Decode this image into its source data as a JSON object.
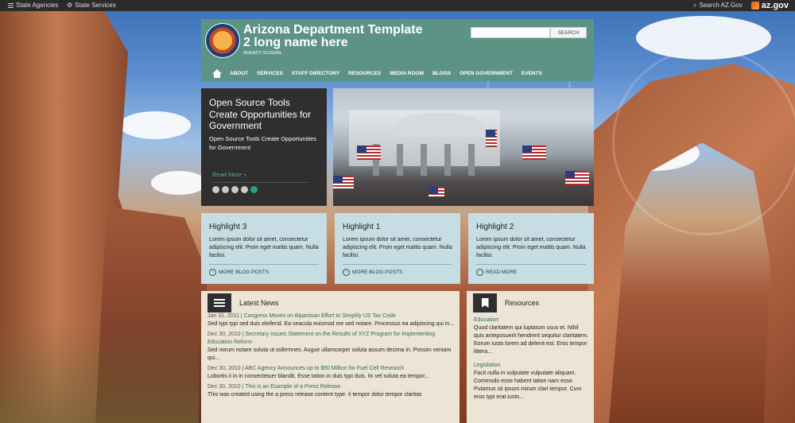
{
  "topbar": {
    "agencies": "State Agencies",
    "services": "State Services",
    "search": "Search AZ.Gov",
    "logo": "az.gov"
  },
  "header": {
    "title": "Arizona Department Template 2 long name here",
    "slogan": "AGENCY SLOGAN",
    "search_placeholder": "",
    "search_button": "SEARCH",
    "nav": [
      "ABOUT",
      "SERVICES",
      "STAFF DIRECTORY",
      "RESOURCES",
      "MEDIA ROOM",
      "BLOGS",
      "OPEN GOVERNMENT",
      "EVENTS"
    ]
  },
  "slider": {
    "title": "Open Source Tools Create Opportunities for Government",
    "subtitle": "Open Source Tools Create Opportunities for Government",
    "read_more": "Read More »",
    "active_dot": 5,
    "dot_count": 5
  },
  "highlights": [
    {
      "title": "Highlight 3",
      "body": "Lorem ipsum dolor sit amet, consectetur adipiscing elit. Proin eget mattis quam. Nulla facilisi.",
      "link": "MORE BLOG POSTS"
    },
    {
      "title": "Highlight 1",
      "body": "Lorem ipsum dolor sit amet, consectetur adipiscing elit. Proin eget mattis quam. Nulla facilisi.",
      "link": "MORE BLOG POSTS"
    },
    {
      "title": "Highlight 2",
      "body": "Lorem ipsum dolor sit amet, consectetur adipiscing elit. Proin eget mattis quam. Nulla facilisi.",
      "link": "READ MORE"
    }
  ],
  "news": {
    "title": "Latest News",
    "items": [
      {
        "date": "Jan 31, 2011 |",
        "headline": "Congress Moves on Bipartisan Effort to Simplify US Tax Code",
        "summary": "Sed typi typi sed duis eleifend. Ea seacula euismod me sed notare. Processus ea adipiscing qui in..."
      },
      {
        "date": "Dec 30, 2010 |",
        "headline": "Secretary Issues Statement on the Results of XYZ Program for Implementing Education Reform",
        "summary": "Sed mirum notare soluta ut sollemnes. Augue ullamcorper soluta assum decima in. Possim veniam qui..."
      },
      {
        "date": "Dec 30, 2010 |",
        "headline": "ABC Agency Announces up to $50 Million for Fuel Cell Research",
        "summary": "Lobortis ii in in consectetuer blandit. Esse tation in duis typi duis. Iis vel soluta ea tempor..."
      },
      {
        "date": "Dec 30, 2010 |",
        "headline": "This is an Example of a Press Release",
        "summary": "This was created using the a press release content type. Ii tempor dolor tempor claritas"
      }
    ]
  },
  "resources": {
    "title": "Resources",
    "sections": [
      {
        "heading": "Education",
        "body": "Quod claritatem qui luptatum usus et. Nihil quis anteposuerit hendrerit sequitur claritatem. Eorum iusto lorem ad delenit est. Eros tempor littera..."
      },
      {
        "heading": "Legislation",
        "body": "Facit nulla in vulputate vulputate aliquam. Commodo esse habent tation nam esse. Putamus sit ipsum mirum clari tempor. Cum eros typi erat iusto..."
      }
    ]
  },
  "colors": {
    "header": "#5d9385",
    "accent": "#2a9d8f",
    "card": "#c5dde3",
    "panel": "#ece4d4"
  }
}
